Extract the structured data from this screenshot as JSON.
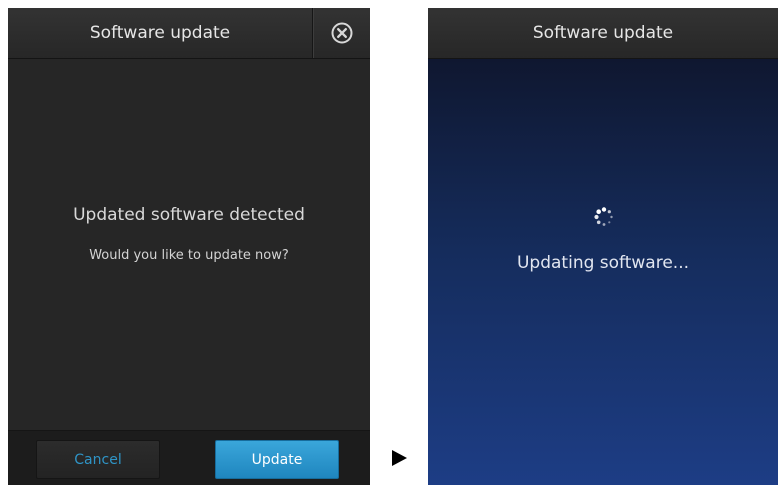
{
  "left_screen": {
    "header": {
      "title": "Software update",
      "close_icon": "close-circle-icon"
    },
    "message": {
      "title": "Updated software detected",
      "subtitle": "Would you like to update now?"
    },
    "footer": {
      "cancel_label": "Cancel",
      "update_label": "Update"
    }
  },
  "flow_arrow_icon": "play-arrow-icon",
  "right_screen": {
    "header": {
      "title": "Software update"
    },
    "spinner_icon": "loading-spinner-icon",
    "status_text": "Updating software..."
  },
  "colors": {
    "accent": "#2f94c6",
    "update_button": "#2a93cc",
    "dark_background": "#262626",
    "updating_background_top": "#0f1730",
    "updating_background_bottom": "#1d3d85"
  }
}
